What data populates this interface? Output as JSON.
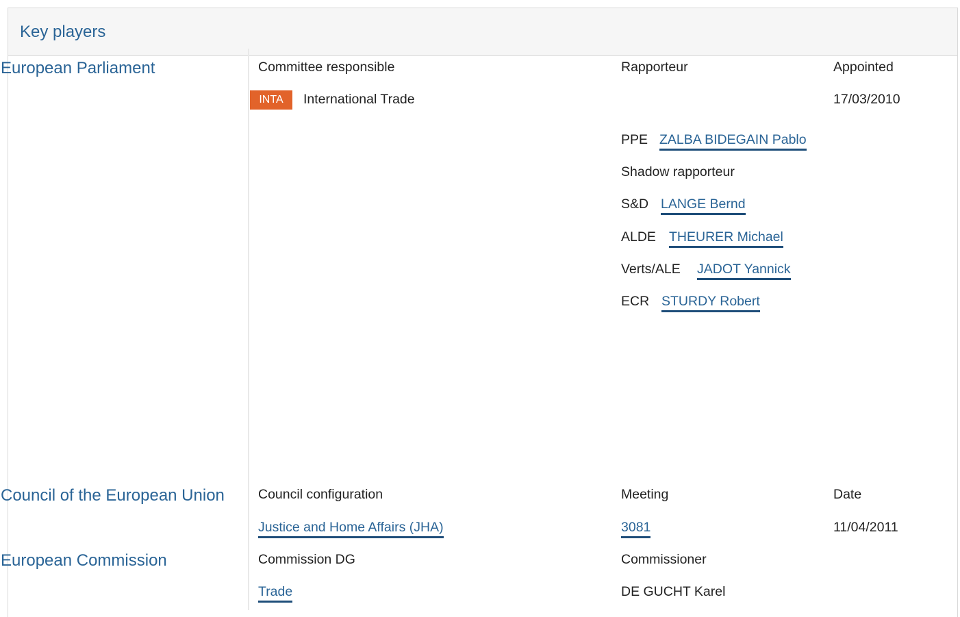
{
  "panel": {
    "title": "Key players"
  },
  "parliament": {
    "label": "European Parliament",
    "headers": {
      "committee": "Committee responsible",
      "rapporteur": "Rapporteur",
      "appointed": "Appointed"
    },
    "committee": {
      "code": "INTA",
      "name": "International Trade",
      "appointed": "17/03/2010"
    },
    "rapporteur": {
      "group": "PPE",
      "name": "ZALBA BIDEGAIN Pablo"
    },
    "shadow_heading": "Shadow rapporteur",
    "shadows": [
      {
        "group": "S&D",
        "name": "LANGE Bernd"
      },
      {
        "group": "ALDE",
        "name": "THEURER Michael"
      },
      {
        "group": "Verts/ALE",
        "name": "JADOT Yannick"
      },
      {
        "group": "ECR",
        "name": "STURDY Robert"
      }
    ]
  },
  "council": {
    "label": "Council of the European Union",
    "headers": {
      "configuration": "Council configuration",
      "meeting": "Meeting",
      "date": "Date"
    },
    "configuration": "Justice and Home Affairs (JHA)",
    "meeting": "3081",
    "date": "11/04/2011"
  },
  "commission": {
    "label": "European Commission",
    "headers": {
      "dg": "Commission DG",
      "commissioner": "Commissioner"
    },
    "dg": "Trade",
    "commissioner": "DE GUCHT Karel"
  },
  "colors": {
    "accent_link": "#2a6496",
    "badge": "#e2632a",
    "header_bg": "#f6f6f6"
  }
}
